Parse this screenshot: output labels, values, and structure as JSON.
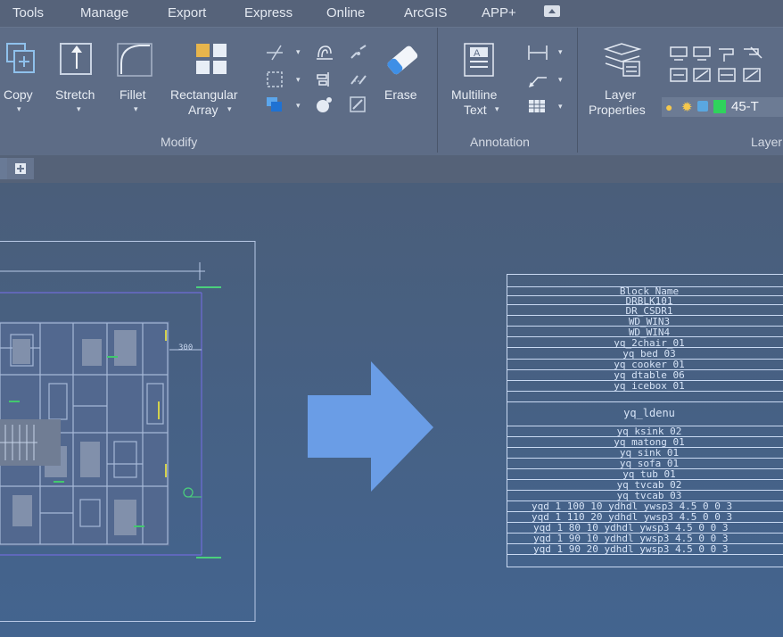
{
  "menu": {
    "items": [
      "Tools",
      "Manage",
      "Export",
      "Express",
      "Online",
      "ArcGIS",
      "APP+"
    ],
    "extra_icon": "minimize-ribbon-icon"
  },
  "ribbon": {
    "modify": {
      "title": "Modify",
      "tools": {
        "copy": "Copy",
        "stretch": "Stretch",
        "fillet": "Fillet",
        "rect_array_1": "Rectangular",
        "rect_array_2": "Array",
        "erase": "Erase"
      }
    },
    "annotation": {
      "title": "Annotation",
      "multiline_1": "Multiline",
      "multiline_2": "Text"
    },
    "layers": {
      "title": "Layer",
      "properties_1": "Layer",
      "properties_2": "Properties",
      "current_layer": "45-T"
    }
  },
  "drawing": {
    "dimension_label": "300"
  },
  "table": {
    "header": "Block Name",
    "rows": [
      "DRBLK101",
      "DR_CSDR1",
      "WD_WIN3",
      "WD_WIN4",
      "yq_2chair_01",
      "yq_bed_03",
      "yq_cooker_01",
      "yq_dtable_06",
      "yq_icebox_01",
      "yq_ldenu",
      "yq_ksink_02",
      "yq_matong_01",
      "yq_sink_01",
      "yq_sofa_01",
      "yq_tub_01",
      "yq_tvcab_02",
      "yq_tvcab_03",
      "yqd_1_100_10_ydhdl_ywsp3_4.5_0_0_3",
      "yqd_1_110_20_ydhdl_ywsp3_4.5_0_0_3",
      "yqd_1_80_10_ydhdl_ywsp3_4.5_0_0_3",
      "yqd_1_90_10_ydhdl_ywsp3_4.5_0_0_3",
      "yqd_1_90_20_ydhdl_ywsp3_4.5_0_0_3"
    ]
  },
  "colors": {
    "accent_arrow": "#6a9de6",
    "table_lines": "#c9d9f2",
    "cad_lines": "#9bb3d9"
  }
}
